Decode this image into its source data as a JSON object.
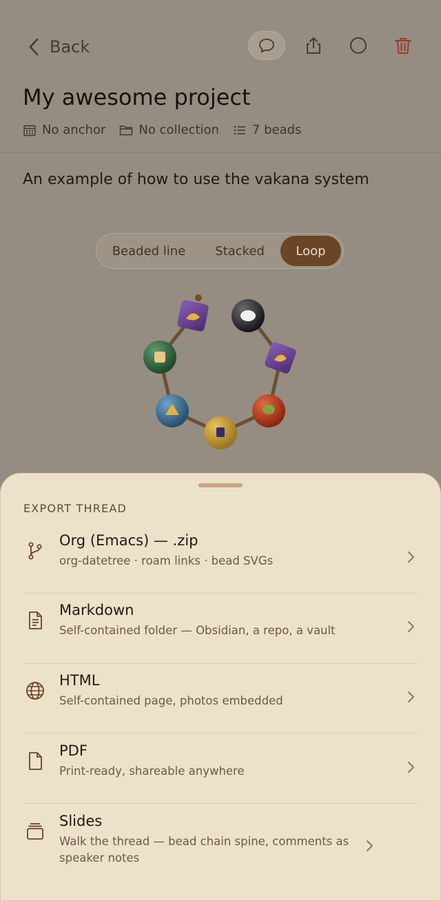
{
  "header": {
    "back_label": "Back"
  },
  "project": {
    "title": "My awesome project",
    "anchor": "No anchor",
    "collection": "No collection",
    "beads": "7 beads",
    "description": "An example of how to use the vakana system"
  },
  "view_modes": {
    "options": [
      "Beaded line",
      "Stacked",
      "Loop"
    ],
    "selected": "Loop"
  },
  "export_sheet": {
    "title": "EXPORT THREAD",
    "items": [
      {
        "title": "Org (Emacs) — .zip",
        "subtitle": "org-datetree · roam links · bead SVGs",
        "icon": "branch-icon"
      },
      {
        "title": "Markdown",
        "subtitle": "Self-contained folder — Obsidian, a repo, a vault",
        "icon": "document-icon"
      },
      {
        "title": "HTML",
        "subtitle": "Self-contained page, photos embedded",
        "icon": "globe-icon"
      },
      {
        "title": "PDF",
        "subtitle": "Print-ready, shareable anywhere",
        "icon": "file-icon"
      },
      {
        "title": "Slides",
        "subtitle": "Walk the thread — bead chain spine, comments as speaker notes",
        "icon": "slides-icon"
      }
    ]
  },
  "colors": {
    "accent": "#6a4528",
    "delete": "#a0382a",
    "sheet_bg": "#ece1c9",
    "dim_bg": "#958d82"
  }
}
